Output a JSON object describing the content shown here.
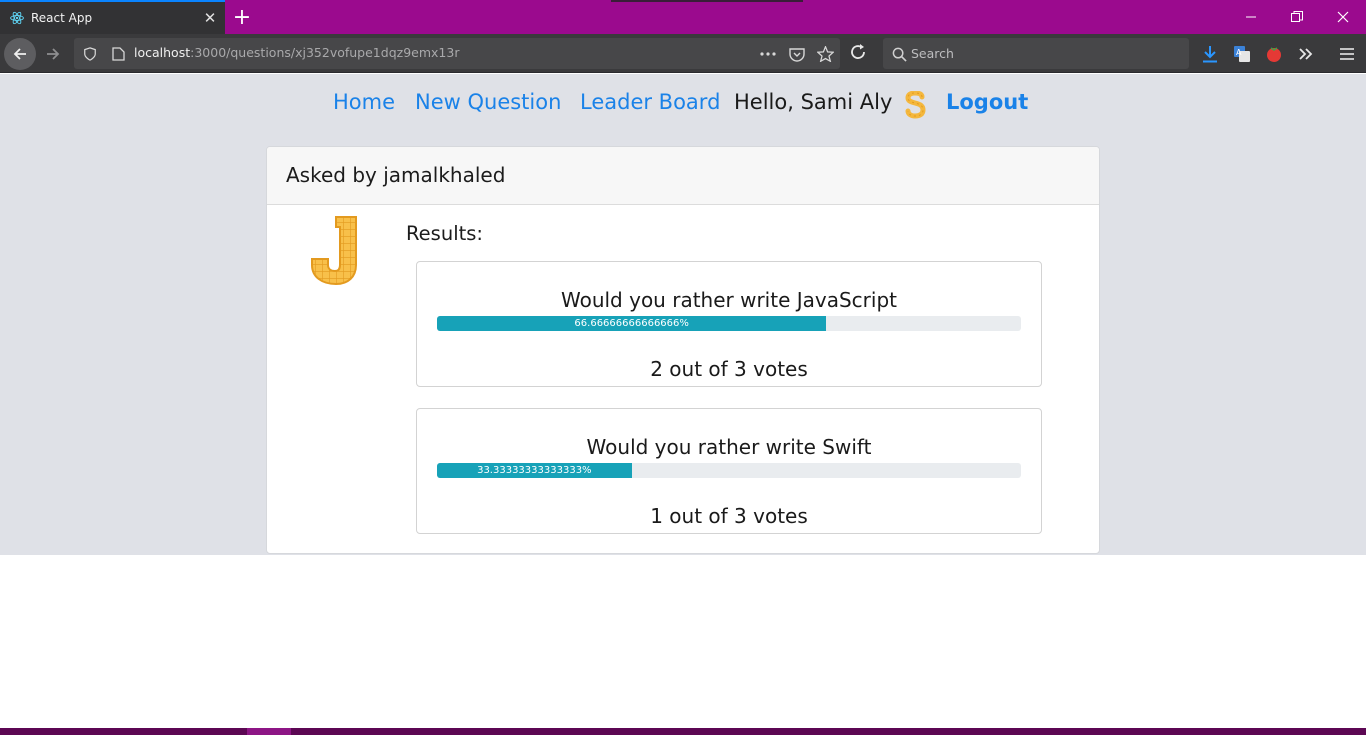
{
  "browser": {
    "tab_title": "React App",
    "url_host": "localhost",
    "url_rest": ":3000/questions/xj352vofupe1dqz9emx13r",
    "search_placeholder": "Search",
    "colors": {
      "tabbar": "#9b0a8e",
      "accent": "#0a84ff"
    }
  },
  "nav": {
    "links": [
      "Home",
      "New Question",
      "Leader Board"
    ],
    "greeting": "Hello, Sami Aly",
    "logout": "Logout"
  },
  "question": {
    "asked_by": "Asked by jamalkhaled",
    "results_label": "Results:",
    "options": [
      {
        "text": "Would you rather write JavaScript",
        "percent_label": "66.66666666666666%",
        "percent": 66.66666666666666,
        "votes_text": "2 out of 3 votes"
      },
      {
        "text": "Would you rather write Swift",
        "percent_label": "33.33333333333333%",
        "percent": 33.33333333333333,
        "votes_text": "1 out of 3 votes"
      }
    ]
  },
  "colors": {
    "link": "#1a82e8",
    "progress": "#17a2b8",
    "page_bg": "#dfe1e7"
  }
}
